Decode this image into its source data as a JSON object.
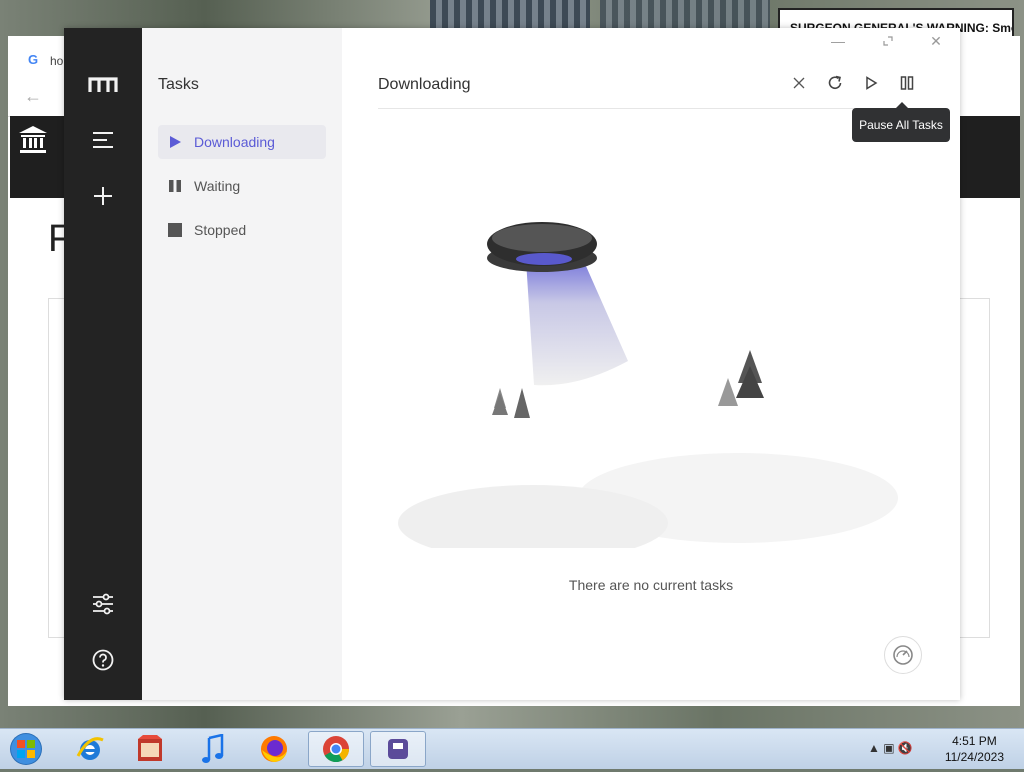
{
  "desktop": {
    "warning_text": "SURGEON GENERAL'S WARNING: Smoking"
  },
  "browser": {
    "tab_label": "ho",
    "favicon": "G"
  },
  "app": {
    "sidebar": {
      "title": "Tasks",
      "items": [
        {
          "label": "Downloading",
          "icon": "play-icon",
          "active": true
        },
        {
          "label": "Waiting",
          "icon": "pause-icon",
          "active": false
        },
        {
          "label": "Stopped",
          "icon": "stop-icon",
          "active": false
        }
      ]
    },
    "main": {
      "title": "Downloading",
      "tooltip": "Pause All Tasks",
      "empty_text": "There are no current tasks"
    },
    "colors": {
      "rail": "#232323",
      "accent": "#5b5bd6",
      "subpanel": "#f4f4f5"
    }
  },
  "taskbar": {
    "apps": [
      "internet-explorer-icon",
      "app-store-icon",
      "itunes-icon",
      "firefox-icon",
      "chrome-icon",
      "motrix-icon"
    ],
    "time": "4:51 PM",
    "date": "11/24/2023"
  }
}
